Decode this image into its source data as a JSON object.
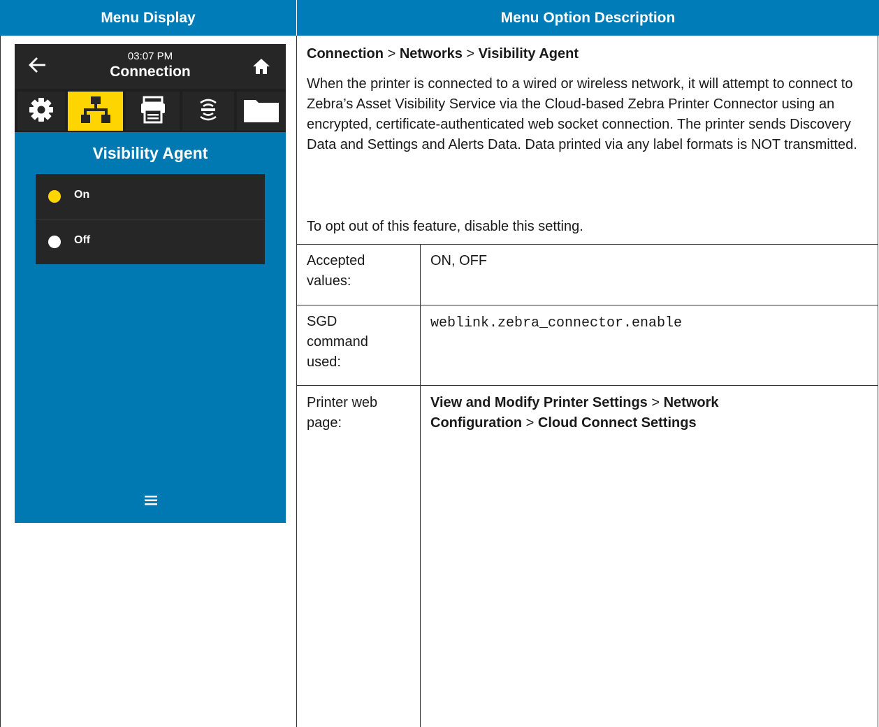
{
  "header": {
    "left": "Menu Display",
    "right": "Menu Option Description"
  },
  "device": {
    "time": "03:07 PM",
    "title": "Connection",
    "tabs": [
      "settings-icon",
      "network-icon",
      "printer-icon",
      "rfid-icon",
      "folder-icon"
    ],
    "active_tab": "network-icon",
    "screen_title": "Visibility Agent",
    "options": [
      {
        "label": "On",
        "selected": true,
        "dot_color": "#ffd500"
      },
      {
        "label": "Off",
        "selected": false,
        "dot_color": "#ffffff"
      }
    ],
    "accent": "#ffd500",
    "background": "#0079b2"
  },
  "description": {
    "breadcrumb": [
      "Connection",
      "Networks",
      "Visibility Agent"
    ],
    "sep": ">",
    "para1": "When the printer is connected to a wired or wireless network, it will attempt to connect to Zebra’s Asset Visibility Service via the Cloud-based Zebra Printer Connector using an encrypted, certificate-authenticated web socket connection. The printer sends Discovery Data and Settings and Alerts Data. Data printed via any label formats is NOT transmitted.",
    "para2": "To opt out of this feature, disable this setting."
  },
  "rows": {
    "accepted_label_1": "Accepted",
    "accepted_label_2": "values:",
    "accepted_value": "ON, OFF",
    "sgd_label_1": "SGD",
    "sgd_label_2": "command",
    "sgd_label_3": "used:",
    "sgd_value": "weblink.zebra_connector.enable",
    "web_label_1": "Printer web",
    "web_label_2": "page:",
    "web_part1": "View and Modify Printer Settings",
    "web_part2": "Network",
    "web_part3": "Configuration",
    "web_part4": "Cloud Connect Settings",
    "sep": ">"
  }
}
